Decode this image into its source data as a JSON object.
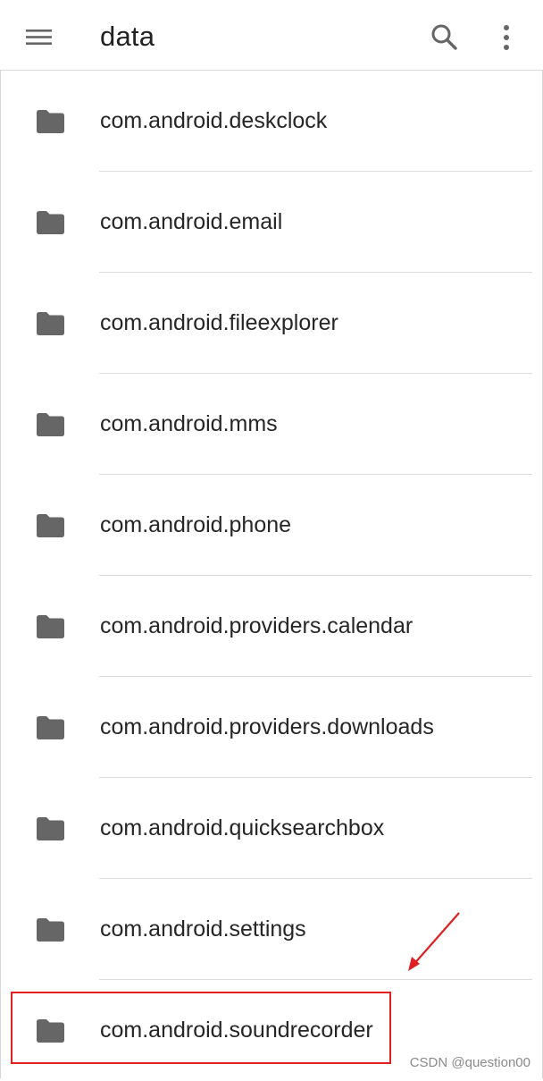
{
  "app": {
    "title": "data",
    "menu_icon": "hamburger-menu-icon",
    "search_icon": "search-icon",
    "more_icon": "more-vertical-icon"
  },
  "folders": [
    {
      "name": "com.android.deskclock",
      "icon": "folder-icon"
    },
    {
      "name": "com.android.email",
      "icon": "folder-icon"
    },
    {
      "name": "com.android.fileexplorer",
      "icon": "folder-icon"
    },
    {
      "name": "com.android.mms",
      "icon": "folder-icon"
    },
    {
      "name": "com.android.phone",
      "icon": "folder-icon"
    },
    {
      "name": "com.android.providers.calendar",
      "icon": "folder-icon"
    },
    {
      "name": "com.android.providers.downloads",
      "icon": "folder-icon"
    },
    {
      "name": "com.android.quicksearchbox",
      "icon": "folder-icon"
    },
    {
      "name": "com.android.settings",
      "icon": "folder-icon"
    },
    {
      "name": "com.android.soundrecorder",
      "icon": "folder-icon"
    }
  ],
  "annotation": {
    "highlighted_item": "com.android.soundrecorder",
    "color": "#e02020"
  },
  "watermark": "CSDN @question00",
  "colors": {
    "icon": "#666666",
    "text": "#262626",
    "divider": "#dcdcdc"
  }
}
